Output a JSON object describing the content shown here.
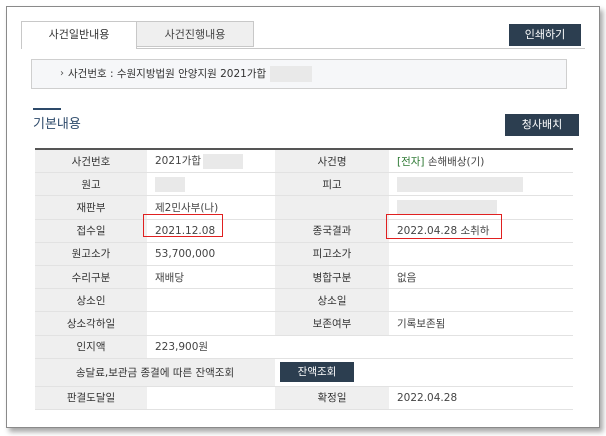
{
  "tabs": [
    {
      "label": "사건일반내용",
      "active": true
    },
    {
      "label": "사건진행내용",
      "active": false
    }
  ],
  "print_label": "인쇄하기",
  "case_header": {
    "text": "사건번호 : 수원지방법원 안양지원 2021가합"
  },
  "section_title": "기본내용",
  "claim_label": "청사배치",
  "rows": {
    "case_no_label": "사건번호",
    "case_no_value": "2021가합",
    "case_name_label": "사건명",
    "case_name_tag": "[전자]",
    "case_name_value": "손해배상(기)",
    "plaintiff_label": "원고",
    "defendant_label": "피고",
    "division_label": "재판부",
    "division_value": "제2민사부(나)",
    "receipt_label": "접수일",
    "receipt_value": "2021.12.08",
    "end_label": "종국결과",
    "end_value": "2022.04.28 소취하",
    "plaintiff_amount_label": "원고소가",
    "plaintiff_amount_value": "53,700,000",
    "defendant_amount_label": "피고소가",
    "acceptance_label": "수리구분",
    "acceptance_value": "재배당",
    "merge_label": "병합구분",
    "merge_value": "없음",
    "appellant_label": "상소인",
    "appeal_date_label": "상소일",
    "appeal_dismiss_label": "상소각하일",
    "preservation_label": "보존여부",
    "preservation_value": "기록보존됨",
    "stamp_label": "인지액",
    "stamp_value": "223,900원",
    "balance_label": "송달료,보관금 종결에 따른 잔액조회",
    "balance_button": "잔액조회",
    "delivery_label": "판결도달일",
    "confirm_label": "확정일",
    "confirm_value": "2022.04.28"
  }
}
